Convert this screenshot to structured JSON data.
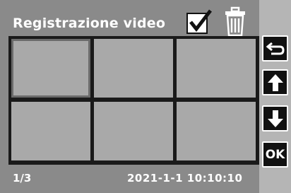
{
  "header": {
    "title": "Registrazione video",
    "select_icon": "checkbox-checked-icon",
    "delete_icon": "trash-icon"
  },
  "grid": {
    "rows": 2,
    "columns": 3,
    "selected_index": 0
  },
  "footer": {
    "page": "1/3",
    "datetime": "2021-1-1  10:10:10"
  },
  "sidebar": {
    "back_icon": "return-arrow-icon",
    "up_icon": "arrow-up-icon",
    "down_icon": "arrow-down-icon",
    "ok_label": "OK"
  },
  "colors": {
    "background": "#8a8a8a",
    "sidebar": "#b5b5b5",
    "thumbnail": "#a9a9a9",
    "grid_lines": "#1a1a1a",
    "button": "#111111",
    "text": "#ffffff"
  }
}
